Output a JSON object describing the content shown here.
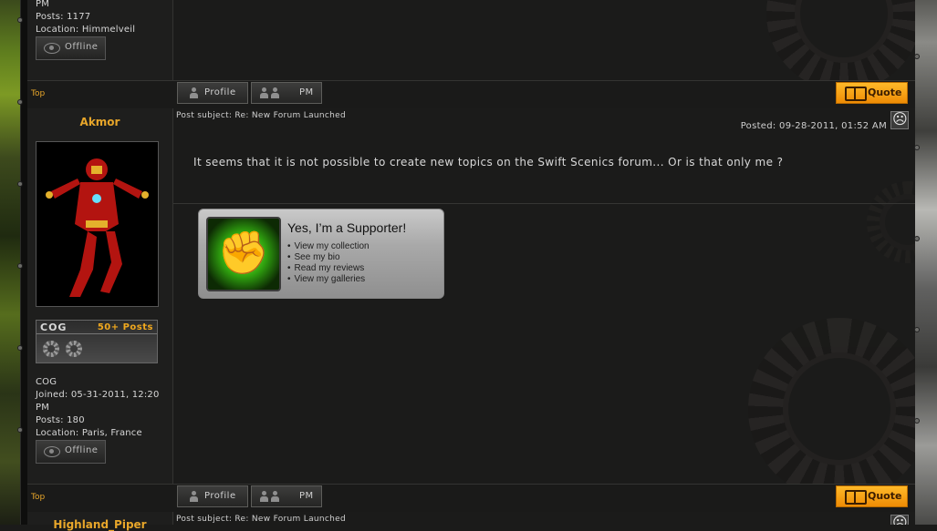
{
  "user1": {
    "joined_tail": "PM",
    "posts": "Posts: 1177",
    "location": "Location: Himmelveil",
    "status": "Offline"
  },
  "post1_footer": {
    "top": "Top",
    "profile": "Profile",
    "pm": "PM",
    "quote": "Quote"
  },
  "post2": {
    "username": "Akmor",
    "rank_name": "COG",
    "rank_posts": "50+ Posts",
    "rank": "COG",
    "joined": "Joined: 05-31-2011, 12:20",
    "joined_tail": "PM",
    "posts": "Posts: 180",
    "location": "Location: Paris, France",
    "status": "Offline",
    "subject": "Post subject: Re: New Forum Launched",
    "posted": "Posted: 09-28-2011, 01:52 AM",
    "body": "It seems that it is not possible to create new topics on the Swift Scenics forum... Or is that only me ?",
    "mood_icon": "frown-icon",
    "signature": {
      "title": "Yes, I’m a Supporter!",
      "items": [
        "View my collection",
        "See my bio",
        "Read my reviews",
        "View my galleries"
      ]
    },
    "top": "Top",
    "profile": "Profile",
    "pm": "PM",
    "quote": "Quote"
  },
  "post3": {
    "username": "Highland_Piper",
    "subject": "Post subject: Re: New Forum Launched"
  },
  "colors": {
    "accent": "#e8a62a",
    "quote_button": "#f59a10",
    "background": "#1b1b1a"
  }
}
